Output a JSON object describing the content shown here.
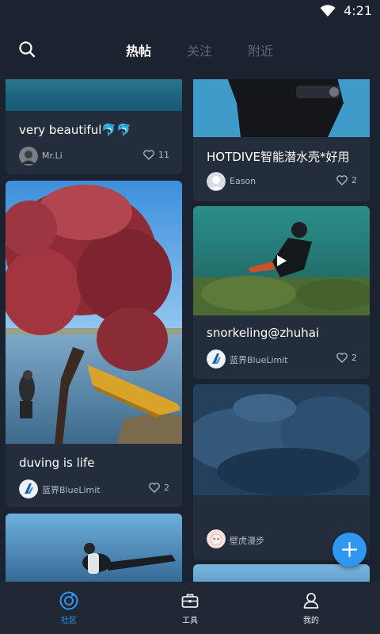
{
  "status_bar": {
    "time": "4:21"
  },
  "top_nav": {
    "tabs": [
      {
        "label": "热帖",
        "active": true
      },
      {
        "label": "关注",
        "active": false
      },
      {
        "label": "附近",
        "active": false
      }
    ]
  },
  "feed": {
    "left_column": [
      {
        "caption": "very beautiful🐬🐬",
        "author": "Mr.Li",
        "likes": "11"
      },
      {
        "caption": "duving is life",
        "author": "蓝界BlueLimit",
        "likes": "2"
      },
      {
        "caption": "",
        "author": "",
        "likes": ""
      }
    ],
    "right_column": [
      {
        "caption": "HOTDIVE智能潜水壳*好用",
        "author": "Eason",
        "likes": "2"
      },
      {
        "caption": "snorkeling@zhuhai",
        "author": "蓝界BlueLimit",
        "likes": "2",
        "is_video": true
      },
      {
        "caption": "",
        "author": "壁虎漫步",
        "likes": ""
      },
      {
        "caption": "",
        "author": "",
        "likes": ""
      }
    ]
  },
  "bottom_nav": {
    "items": [
      {
        "label": "社区",
        "active": true
      },
      {
        "label": "工具",
        "active": false
      },
      {
        "label": "我的",
        "active": false
      }
    ]
  },
  "colors": {
    "background": "#1b2330",
    "card": "#232d3b",
    "accent": "#2f97f0",
    "muted_text": "#b4bcc7",
    "inactive_tab": "#5c6878"
  },
  "icons": [
    "wifi-icon",
    "search-icon",
    "heart-icon",
    "play-icon",
    "plus-icon",
    "community-icon",
    "toolbox-icon",
    "profile-icon"
  ]
}
